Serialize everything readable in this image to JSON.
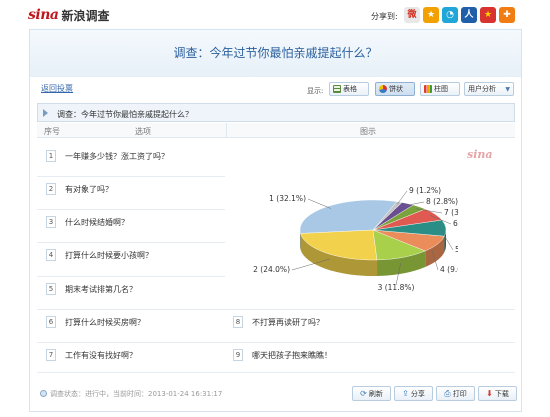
{
  "header": {
    "logo_text": "sina",
    "logo_cn": "新浪调查",
    "share_label": "分享到:",
    "share_icons": [
      {
        "name": "weibo-icon",
        "glyph": "微",
        "color": "#e8e8e8",
        "fg": "#d52b1e"
      },
      {
        "name": "star-icon",
        "glyph": "★",
        "color": "#f2a100",
        "fg": "#ffffff"
      },
      {
        "name": "tencent-icon",
        "glyph": "◔",
        "color": "#20a7d8",
        "fg": "#ffffff"
      },
      {
        "name": "renren-icon",
        "glyph": "人",
        "color": "#1f5ea8",
        "fg": "#ffffff"
      },
      {
        "name": "kaixin-icon",
        "glyph": "★",
        "color": "#d8332f",
        "fg": "#ffd200"
      },
      {
        "name": "plus-icon",
        "glyph": "✚",
        "color": "#f07c12",
        "fg": "#ffffff"
      }
    ]
  },
  "survey": {
    "title": "调查：今年过节你最怕亲戚提起什么？",
    "back_link": "返回投票",
    "display_label": "显示:",
    "view_buttons": [
      {
        "label": "表格",
        "icon": "table-icon",
        "active": false
      },
      {
        "label": "饼状",
        "icon": "pie-icon",
        "active": true
      },
      {
        "label": "柱图",
        "icon": "bar-icon",
        "active": false
      },
      {
        "label": "用户分析",
        "icon": "dropdown-icon",
        "active": false
      }
    ],
    "question": "调查：今年过节你最怕亲戚提起什么？",
    "col_num": "序号",
    "col_option": "选项",
    "col_chart": "图示"
  },
  "options": [
    {
      "num": "1",
      "text": "一年赚多少钱？涨工资了吗？"
    },
    {
      "num": "2",
      "text": "有对象了吗？"
    },
    {
      "num": "3",
      "text": "什么时候结婚啊？"
    },
    {
      "num": "4",
      "text": "打算什么时候要小孩啊？"
    },
    {
      "num": "5",
      "text": "期末考试排第几名？"
    },
    {
      "num": "6",
      "text": "打算什么时候买房啊？"
    },
    {
      "num": "7",
      "text": "工作有没有找好啊？"
    },
    {
      "num": "8",
      "text": "不打算再读研了吗？"
    },
    {
      "num": "9",
      "text": "哪天把孩子抱来瞧瞧！"
    }
  ],
  "watermark": "sina",
  "chart_data": {
    "type": "pie",
    "categories": [
      "1",
      "2",
      "3",
      "4",
      "5",
      "6",
      "7",
      "8",
      "9"
    ],
    "values": [
      32.1,
      24.0,
      11.8,
      9.0,
      8.7,
      6.9,
      3.4,
      2.8,
      1.2
    ],
    "labels": [
      "1 (32.1%)",
      "2 (24.0%)",
      "3 (11.8%)",
      "4 (9.0%)",
      "5 (8.7%)",
      "6 (6.9%)",
      "7 (3.4%)",
      "8 (2.8%)",
      "9 (1.2%)"
    ],
    "colors": [
      "#a8c8e6",
      "#f2d24c",
      "#a8d04a",
      "#eb8d5a",
      "#2a8e86",
      "#e15a52",
      "#7ba33c",
      "#6a4e93",
      "#c4c4c4"
    ],
    "style": "3d"
  },
  "footer": {
    "status": "调查状态：进行中，当前时间：2013-01-24 16:31:17",
    "buttons": [
      {
        "label": "刷新",
        "icon": "refresh-icon",
        "glyph": "⟳"
      },
      {
        "label": "分享",
        "icon": "share-icon",
        "glyph": "⇪"
      },
      {
        "label": "打印",
        "icon": "print-icon",
        "glyph": "⎙"
      },
      {
        "label": "下载",
        "icon": "download-icon",
        "glyph": "⬇"
      }
    ]
  }
}
